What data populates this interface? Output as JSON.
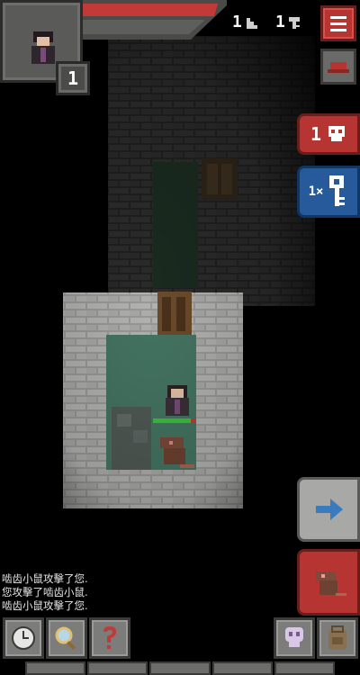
{
  "hero": {
    "level": "1",
    "hp_fraction": 1.0,
    "exp_fraction": 0.0
  },
  "status": {
    "depth": "1",
    "iron_keys": "1"
  },
  "danger": {
    "count": "1"
  },
  "keys_panel": {
    "multiplier": "1×"
  },
  "log": {
    "lines": [
      "啮齿小鼠攻擊了您.",
      "您攻擊了啮齿小鼠.",
      "啮齿小鼠攻擊了您."
    ]
  },
  "icons": {
    "depth": "stairs-icon",
    "key": "iron-key-icon",
    "menu": "hamburger-menu-icon",
    "danger": "skull-icon",
    "wait": "clock-icon",
    "search": "magnifier-icon",
    "info": "question-mark-icon",
    "journal": "skull-journal-icon",
    "backpack": "backpack-icon",
    "resume": "arrow-right-icon"
  },
  "colors": {
    "red_button": "#b63431",
    "blue_badge": "#275a9a",
    "hp_bar": "#c23a37",
    "enemy_hp": "#3ec13a"
  }
}
